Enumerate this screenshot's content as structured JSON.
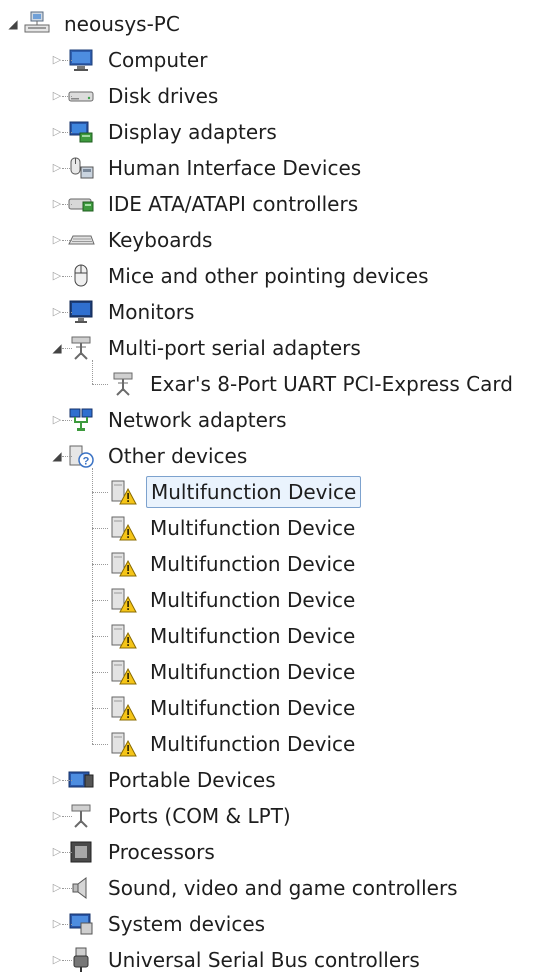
{
  "root": {
    "label": "neousys-PC",
    "icon": "computer-network-icon"
  },
  "categories": [
    {
      "label": "Computer",
      "icon": "computer-icon",
      "expanded": false
    },
    {
      "label": "Disk drives",
      "icon": "disk-drive-icon",
      "expanded": false
    },
    {
      "label": "Display adapters",
      "icon": "display-adapter-icon",
      "expanded": false
    },
    {
      "label": "Human Interface Devices",
      "icon": "hid-icon",
      "expanded": false
    },
    {
      "label": "IDE ATA/ATAPI controllers",
      "icon": "ide-controller-icon",
      "expanded": false
    },
    {
      "label": "Keyboards",
      "icon": "keyboard-icon",
      "expanded": false
    },
    {
      "label": "Mice and other pointing devices",
      "icon": "mouse-icon",
      "expanded": false
    },
    {
      "label": "Monitors",
      "icon": "monitor-icon",
      "expanded": false
    },
    {
      "label": "Multi-port serial adapters",
      "icon": "serial-port-icon",
      "expanded": true,
      "children": [
        {
          "label": "Exar's 8-Port UART PCI-Express Card",
          "icon": "serial-port-icon"
        }
      ]
    },
    {
      "label": "Network adapters",
      "icon": "network-adapter-icon",
      "expanded": false
    },
    {
      "label": "Other devices",
      "icon": "unknown-device-icon",
      "expanded": true,
      "children": [
        {
          "label": "Multifunction Device",
          "icon": "warning-device-icon",
          "selected": true
        },
        {
          "label": "Multifunction Device",
          "icon": "warning-device-icon"
        },
        {
          "label": "Multifunction Device",
          "icon": "warning-device-icon"
        },
        {
          "label": "Multifunction Device",
          "icon": "warning-device-icon"
        },
        {
          "label": "Multifunction Device",
          "icon": "warning-device-icon"
        },
        {
          "label": "Multifunction Device",
          "icon": "warning-device-icon"
        },
        {
          "label": "Multifunction Device",
          "icon": "warning-device-icon"
        },
        {
          "label": "Multifunction Device",
          "icon": "warning-device-icon"
        }
      ]
    },
    {
      "label": "Portable Devices",
      "icon": "portable-device-icon",
      "expanded": false
    },
    {
      "label": "Ports (COM & LPT)",
      "icon": "port-icon",
      "expanded": false
    },
    {
      "label": "Processors",
      "icon": "processor-icon",
      "expanded": false
    },
    {
      "label": "Sound, video and game controllers",
      "icon": "speaker-icon",
      "expanded": false
    },
    {
      "label": "System devices",
      "icon": "system-device-icon",
      "expanded": false
    },
    {
      "label": "Universal Serial Bus controllers",
      "icon": "usb-icon",
      "expanded": false
    }
  ]
}
